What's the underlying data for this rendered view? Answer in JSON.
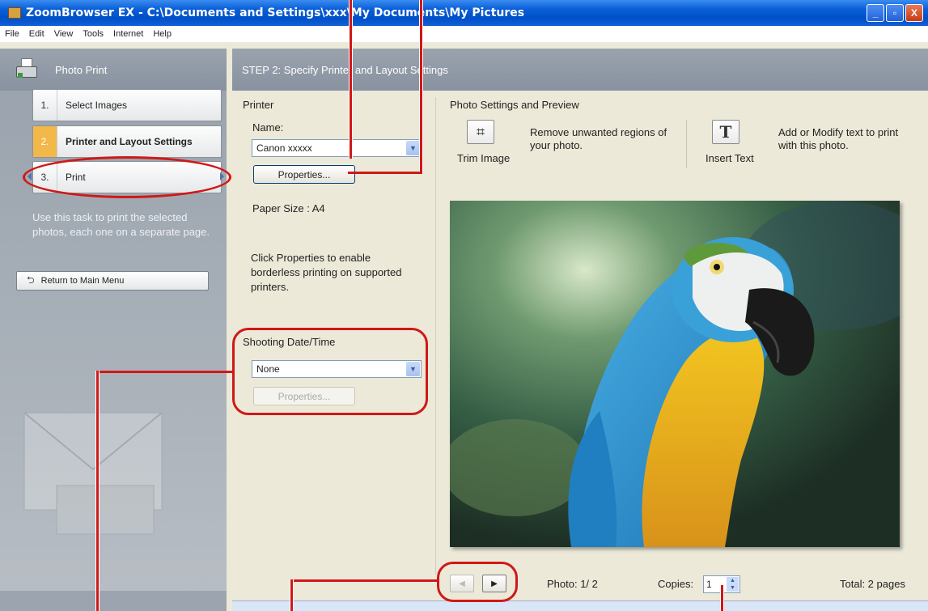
{
  "window": {
    "title": "ZoomBrowser EX  -  C:\\Documents and Settings\\xxx\\My Documents\\My Pictures",
    "controls": [
      "_",
      "▫",
      "X"
    ]
  },
  "menu": [
    "File",
    "Edit",
    "View",
    "Tools",
    "Internet",
    "Help"
  ],
  "sidebar": {
    "header": "Photo Print",
    "steps": [
      {
        "num": "1.",
        "label": "Select Images"
      },
      {
        "num": "2.",
        "label": "Printer and Layout Settings"
      },
      {
        "num": "3.",
        "label": "Print"
      }
    ],
    "description": "Use this task to print the selected photos, each one on a separate page.",
    "return_label": "Return to Main Menu"
  },
  "main": {
    "header": "STEP 2: Specify Printer and Layout Settings",
    "printer": {
      "section_label": "Printer",
      "name_label": "Name:",
      "name_value": "Canon xxxxx",
      "properties_label": "Properties...",
      "paper_size": "Paper Size : A4",
      "note": "Click Properties to enable borderless printing on supported printers."
    },
    "shooting": {
      "label": "Shooting Date/Time",
      "value": "None",
      "properties_label": "Properties..."
    },
    "preview": {
      "section_label": "Photo Settings and Preview",
      "trim_label": "Trim Image",
      "trim_desc": "Remove unwanted regions of your photo.",
      "text_label": "Insert Text",
      "text_desc": "Add or Modify text to print with this photo."
    },
    "footer": {
      "photo": "Photo: 1/ 2",
      "copies_label": "Copies:",
      "copies_value": "1",
      "total": "Total: 2 pages"
    }
  },
  "colors": {
    "titlebar": "#0a5fd8",
    "callout": "#d01818",
    "active_step": "#f2b84a"
  }
}
